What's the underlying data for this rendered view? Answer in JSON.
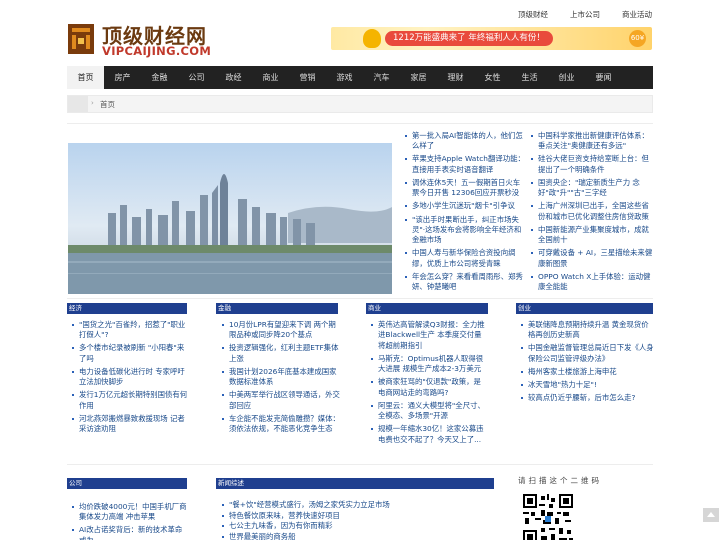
{
  "toplinks": [
    "顶级财经",
    "上市公司",
    "商业活动"
  ],
  "logo": {
    "cn": "顶级财经网",
    "en": "VIPCAIJING.COM"
  },
  "banner": {
    "text": "1212万能盛典来了  年终福利人人有份！",
    "badge": "60¥"
  },
  "nav": [
    "首页",
    "房产",
    "金融",
    "公司",
    "政经",
    "商业",
    "营销",
    "游戏",
    "汽车",
    "家居",
    "理财",
    "女性",
    "生活",
    "创业",
    "要闻"
  ],
  "breadcrumb": {
    "arrow": "›",
    "current": "首页"
  },
  "top_news_mid": [
    "第一批入局AI智能体的人，他们怎么样了",
    "苹果支持Apple Watch翻译功能：直接用手表实时语音翻译",
    "调休连休5天！五一假期首日火车票今日开售 12306回应开票秒没",
    "多地小学生沉迷玩\"烟卡\"引争议",
    "\"该出手时果断出手，纠正市场失灵\"·这场发布会将影响全年经济和金融市场",
    "中国人寿与新华保险合资投向绸缪，优质上市公司将受青睐",
    "年会怎么穿？来看看周雨彤、郑秀妍、钟楚曦吧"
  ],
  "top_news_right": [
    "中国科学家推出新健康评估体系：垂点关注\"奥健康还有多远\"",
    "硅谷大佬巨资支持给室断上台：但提出了一个明确条件",
    "国资央企：\"瑞定新质生产力 念好\"政\"升\"\"古\"三字经",
    "上海广州深圳已出手，全国这些省份和城市已优化调整住房信贷政策",
    "中国新能源产业集聚度城市，成就全国前十",
    "可穿戴设备 + AI，三星描绘未来健康新图景",
    "OPPO Watch X上手体验：运动健康全能能"
  ],
  "sections_row1": [
    {
      "title": "经济",
      "items": [
        "\"国货之光\"百雀羚，招惹了\"职业打假人\"?",
        "多个楼市纪录被刷新 \"小阳春\"来了吗",
        "电力设备低碳化进行时 专家呼吁立法加快脚步",
        "发行1万亿元超长期特别国债有何作用",
        "河北燕郊搬燃暴致救援现场 记者采访途劝阻"
      ]
    },
    {
      "title": "金融",
      "items": [
        "10月份LPR有望迎来下调 两个期限品种或同步降20个基点",
        "投资逻辑强化，红利主题ETF集体上涨",
        "我国计划2026年底基本建成国家数据标准体系",
        "中美两军举行战区领导通话，外交部回应",
        "车企能不能发克简偷雕攒？媒体：须依法依规，不能恶化竞争生态"
      ]
    },
    {
      "title": "商业",
      "items": [
        "英伟达高管解读Q3财报：全力推进Blackwell生产 本季度交付量将超前期指引",
        "马斯克：Optimus机器人取得很大进展 规模生产成本2-3万美元",
        "被商家狂骂的\"仅退款\"政策，是电商网站走的弯路吗?",
        "阿里云：通义大模型将\"全尺寸、全模态、多场景\"开源",
        "规模一年缩水30亿！这家公募违电费也交不起了？今天又上了..."
      ]
    },
    {
      "title": "创业",
      "items": [
        "美联储降息预期持续升温 黄金现货价格再创历史新高",
        "中国金融监督管理总局近日下发《人身保险公司监管评级办法》",
        "梅州客家土楼旅游上海申花",
        "冰天雪地\"热力十足\"!",
        "较高点仍近乎腰斩，后市怎么走?"
      ]
    }
  ],
  "sections_row2": [
    {
      "title": "公司",
      "items": [
        "均价跌破4000元！中国手机厂商集体发力高端 冲击苹果",
        "AI改占诺奖背后：新的技术革命或为"
      ]
    },
    {
      "title": "新闻综述",
      "items": [
        "\"餐+饮\"经营模式盛行，汤姆之家凭实力立足市场",
        "特色餐饮原来味，营养快速好项目",
        "七公主九味香，因为有你而精彩",
        "世界最美丽的商务船"
      ]
    }
  ],
  "qr_label": "请扫描这个二维码"
}
